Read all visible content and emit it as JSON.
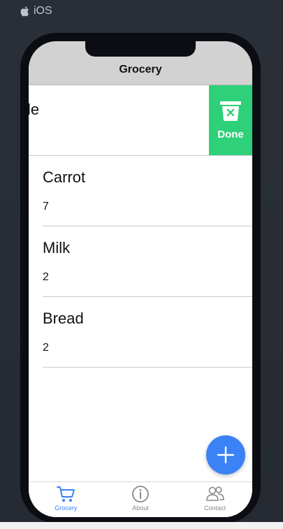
{
  "platform": {
    "label": "iOS",
    "icon": "apple-icon"
  },
  "navbar": {
    "title": "Grocery"
  },
  "swiped_row": {
    "partial_text": "le",
    "action_label": "Done",
    "action_icon": "trash-icon"
  },
  "items": [
    {
      "name": "Carrot",
      "qty": "7"
    },
    {
      "name": "Milk",
      "qty": "2"
    },
    {
      "name": "Bread",
      "qty": "2"
    }
  ],
  "fab": {
    "icon": "plus-icon"
  },
  "tabs": [
    {
      "label": "Grocery",
      "icon": "cart-icon",
      "active": true
    },
    {
      "label": "About",
      "icon": "info-icon",
      "active": false
    },
    {
      "label": "Contact",
      "icon": "people-icon",
      "active": false
    }
  ],
  "colors": {
    "accent": "#3b82f6",
    "done": "#2ed07a",
    "navbar": "#d2d2d2"
  }
}
